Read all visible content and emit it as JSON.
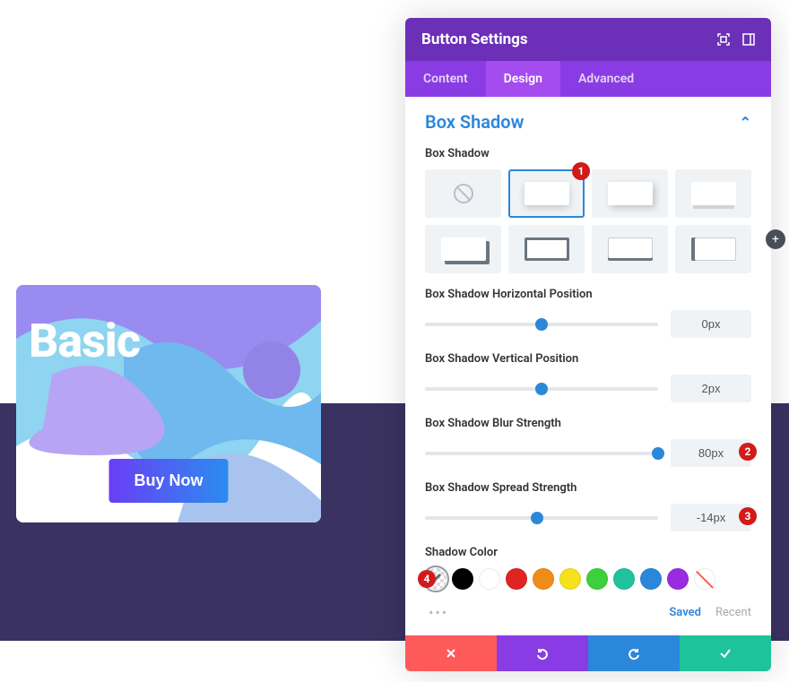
{
  "preview": {
    "title": "Basic",
    "cta": "Buy Now"
  },
  "panel": {
    "title": "Button Settings",
    "tabs": {
      "content": "Content",
      "design": "Design",
      "advanced": "Advanced"
    },
    "section": "Box Shadow",
    "labels": {
      "style": "Box Shadow",
      "hpos": "Box Shadow Horizontal Position",
      "vpos": "Box Shadow Vertical Position",
      "blur": "Box Shadow Blur Strength",
      "spread": "Box Shadow Spread Strength",
      "color": "Shadow Color"
    },
    "values": {
      "hpos": "0px",
      "vpos": "2px",
      "blur": "80px",
      "spread": "-14px"
    },
    "footer": {
      "saved": "Saved",
      "recent": "Recent"
    }
  },
  "colors": {
    "swatches": [
      "#000000",
      "#ffffff",
      "#e02424",
      "#f08c1a",
      "#f5e21a",
      "#3bd13b",
      "#1fc39b",
      "#2b87da",
      "#9a2be0"
    ]
  },
  "badges": {
    "b1": "1",
    "b2": "2",
    "b3": "3",
    "b4": "4"
  }
}
